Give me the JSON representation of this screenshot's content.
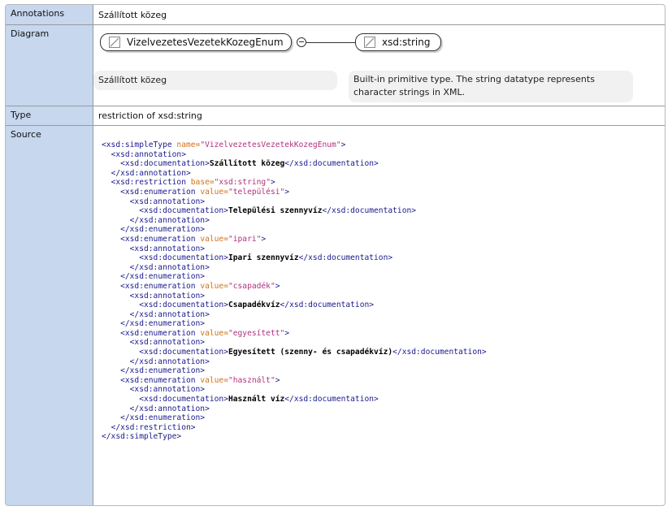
{
  "rows": {
    "annotations": {
      "label": "Annotations",
      "value": "Szállított közeg"
    },
    "diagram": {
      "label": "Diagram",
      "main_node": "VizelvezetesVezetekKozegEnum",
      "main_note": "Szállított közeg",
      "base_node": "xsd:string",
      "base_note_line1": "Built-in primitive type. The string datatype represents",
      "base_note_line2": "character strings in XML."
    },
    "type": {
      "label": "Type",
      "value": "restriction of xsd:string"
    },
    "source": {
      "label": "Source"
    }
  },
  "source_lines": [
    {
      "indent": 0,
      "parts": [
        {
          "c": "tag",
          "t": "<xsd:simpleType "
        },
        {
          "c": "attr",
          "t": "name="
        },
        {
          "c": "val",
          "t": "\"VizelvezetesVezetekKozegEnum\""
        },
        {
          "c": "tag",
          "t": ">"
        }
      ]
    },
    {
      "indent": 1,
      "parts": [
        {
          "c": "tag",
          "t": "<xsd:annotation>"
        }
      ]
    },
    {
      "indent": 2,
      "parts": [
        {
          "c": "tag",
          "t": "<xsd:documentation>"
        },
        {
          "c": "txt",
          "t": "Szállított közeg"
        },
        {
          "c": "tag",
          "t": "</xsd:documentation>"
        }
      ]
    },
    {
      "indent": 1,
      "parts": [
        {
          "c": "tag",
          "t": "</xsd:annotation>"
        }
      ]
    },
    {
      "indent": 1,
      "parts": [
        {
          "c": "tag",
          "t": "<xsd:restriction "
        },
        {
          "c": "attr",
          "t": "base="
        },
        {
          "c": "val",
          "t": "\"xsd:string\""
        },
        {
          "c": "tag",
          "t": ">"
        }
      ]
    },
    {
      "indent": 2,
      "parts": [
        {
          "c": "tag",
          "t": "<xsd:enumeration "
        },
        {
          "c": "attr",
          "t": "value="
        },
        {
          "c": "val",
          "t": "\"települési\""
        },
        {
          "c": "tag",
          "t": ">"
        }
      ]
    },
    {
      "indent": 3,
      "parts": [
        {
          "c": "tag",
          "t": "<xsd:annotation>"
        }
      ]
    },
    {
      "indent": 4,
      "parts": [
        {
          "c": "tag",
          "t": "<xsd:documentation>"
        },
        {
          "c": "txt",
          "t": "Települési szennyvíz"
        },
        {
          "c": "tag",
          "t": "</xsd:documentation>"
        }
      ]
    },
    {
      "indent": 3,
      "parts": [
        {
          "c": "tag",
          "t": "</xsd:annotation>"
        }
      ]
    },
    {
      "indent": 2,
      "parts": [
        {
          "c": "tag",
          "t": "</xsd:enumeration>"
        }
      ]
    },
    {
      "indent": 2,
      "parts": [
        {
          "c": "tag",
          "t": "<xsd:enumeration "
        },
        {
          "c": "attr",
          "t": "value="
        },
        {
          "c": "val",
          "t": "\"ipari\""
        },
        {
          "c": "tag",
          "t": ">"
        }
      ]
    },
    {
      "indent": 3,
      "parts": [
        {
          "c": "tag",
          "t": "<xsd:annotation>"
        }
      ]
    },
    {
      "indent": 4,
      "parts": [
        {
          "c": "tag",
          "t": "<xsd:documentation>"
        },
        {
          "c": "txt",
          "t": "Ipari szennyvíz"
        },
        {
          "c": "tag",
          "t": "</xsd:documentation>"
        }
      ]
    },
    {
      "indent": 3,
      "parts": [
        {
          "c": "tag",
          "t": "</xsd:annotation>"
        }
      ]
    },
    {
      "indent": 2,
      "parts": [
        {
          "c": "tag",
          "t": "</xsd:enumeration>"
        }
      ]
    },
    {
      "indent": 2,
      "parts": [
        {
          "c": "tag",
          "t": "<xsd:enumeration "
        },
        {
          "c": "attr",
          "t": "value="
        },
        {
          "c": "val",
          "t": "\"csapadék\""
        },
        {
          "c": "tag",
          "t": ">"
        }
      ]
    },
    {
      "indent": 3,
      "parts": [
        {
          "c": "tag",
          "t": "<xsd:annotation>"
        }
      ]
    },
    {
      "indent": 4,
      "parts": [
        {
          "c": "tag",
          "t": "<xsd:documentation>"
        },
        {
          "c": "txt",
          "t": "Csapadékvíz"
        },
        {
          "c": "tag",
          "t": "</xsd:documentation>"
        }
      ]
    },
    {
      "indent": 3,
      "parts": [
        {
          "c": "tag",
          "t": "</xsd:annotation>"
        }
      ]
    },
    {
      "indent": 2,
      "parts": [
        {
          "c": "tag",
          "t": "</xsd:enumeration>"
        }
      ]
    },
    {
      "indent": 2,
      "parts": [
        {
          "c": "tag",
          "t": "<xsd:enumeration "
        },
        {
          "c": "attr",
          "t": "value="
        },
        {
          "c": "val",
          "t": "\"egyesített\""
        },
        {
          "c": "tag",
          "t": ">"
        }
      ]
    },
    {
      "indent": 3,
      "parts": [
        {
          "c": "tag",
          "t": "<xsd:annotation>"
        }
      ]
    },
    {
      "indent": 4,
      "parts": [
        {
          "c": "tag",
          "t": "<xsd:documentation>"
        },
        {
          "c": "txt",
          "t": "Egyesített (szenny- és csapadékvíz)"
        },
        {
          "c": "tag",
          "t": "</xsd:documentation>"
        }
      ]
    },
    {
      "indent": 3,
      "parts": [
        {
          "c": "tag",
          "t": "</xsd:annotation>"
        }
      ]
    },
    {
      "indent": 2,
      "parts": [
        {
          "c": "tag",
          "t": "</xsd:enumeration>"
        }
      ]
    },
    {
      "indent": 2,
      "parts": [
        {
          "c": "tag",
          "t": "<xsd:enumeration "
        },
        {
          "c": "attr",
          "t": "value="
        },
        {
          "c": "val",
          "t": "\"használt\""
        },
        {
          "c": "tag",
          "t": ">"
        }
      ]
    },
    {
      "indent": 3,
      "parts": [
        {
          "c": "tag",
          "t": "<xsd:annotation>"
        }
      ]
    },
    {
      "indent": 4,
      "parts": [
        {
          "c": "tag",
          "t": "<xsd:documentation>"
        },
        {
          "c": "txt",
          "t": "Használt víz"
        },
        {
          "c": "tag",
          "t": "</xsd:documentation>"
        }
      ]
    },
    {
      "indent": 3,
      "parts": [
        {
          "c": "tag",
          "t": "</xsd:annotation>"
        }
      ]
    },
    {
      "indent": 2,
      "parts": [
        {
          "c": "tag",
          "t": "</xsd:enumeration>"
        }
      ]
    },
    {
      "indent": 1,
      "parts": [
        {
          "c": "tag",
          "t": "</xsd:restriction>"
        }
      ]
    },
    {
      "indent": 0,
      "parts": [
        {
          "c": "tag",
          "t": "</xsd:simpleType>"
        }
      ]
    }
  ],
  "colors": {
    "label_bg": "#c6d7ee",
    "tag": "#1a1a8c",
    "attr": "#d2721a",
    "val": "#b0327c",
    "text": "#000000"
  }
}
